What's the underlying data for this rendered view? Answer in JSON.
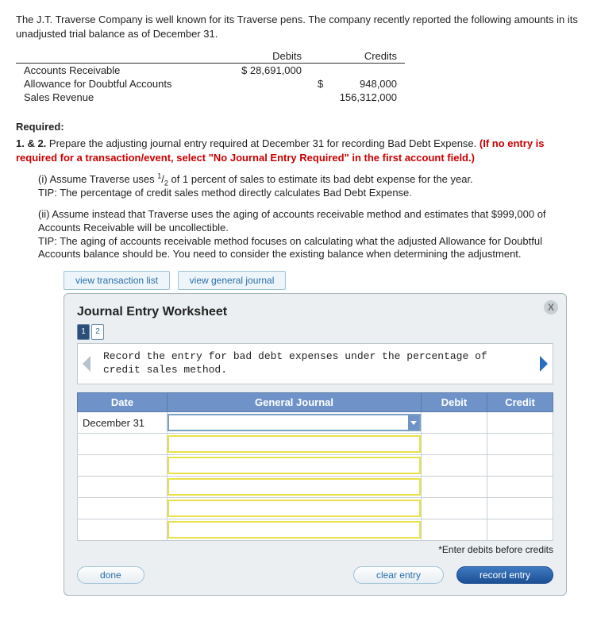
{
  "intro": "The J.T. Traverse Company is well known for its Traverse pens. The company recently reported the following amounts in its unadjusted trial balance as of December 31.",
  "trial": {
    "h_debits": "Debits",
    "h_credits": "Credits",
    "r0_name": "Accounts Receivable",
    "r0_deb": "$  28,691,000",
    "r1_name": "Allowance for Doubtful Accounts",
    "r1_cre_sym": "$",
    "r1_cre": "948,000",
    "r2_name": "Sales Revenue",
    "r2_cre": "156,312,000"
  },
  "req": {
    "label": "Required:",
    "num": "1. & 2.",
    "text": " Prepare the adjusting journal entry required at December 31 for recording Bad Debt Expense. ",
    "red": "(If no entry is required for a transaction/event, select \"No Journal Entry Required\" in the first account field.)",
    "i_a": "(i) Assume Traverse uses ",
    "i_sup": "1",
    "i_slash": "/",
    "i_sub": "2",
    "i_b": " of 1 percent of sales to estimate its bad debt expense for the year.",
    "i_tip": "TIP: The percentage of credit sales method directly calculates Bad Debt Expense.",
    "ii_a": "(ii) Assume instead that Traverse uses the aging of accounts receivable method and estimates that $999,000 of Accounts Receivable will be uncollectible.",
    "ii_tip": "TIP: The aging of accounts receivable method focuses on calculating what the adjusted Allowance for Doubtful Accounts balance should be. You need to consider the existing balance when determining the adjustment."
  },
  "btn_view_tx": "view transaction list",
  "btn_view_gj": "view general journal",
  "ws": {
    "title": "Journal Entry Worksheet",
    "pg1": "1",
    "pg2": "2",
    "instr": "Record the entry for bad debt expenses under the percentage of credit sales method.",
    "h_date": "Date",
    "h_gj": "General Journal",
    "h_debit": "Debit",
    "h_credit": "Credit",
    "date0": "December 31",
    "footnote": "*Enter debits before credits",
    "done": "done",
    "clear": "clear entry",
    "record": "record entry"
  }
}
